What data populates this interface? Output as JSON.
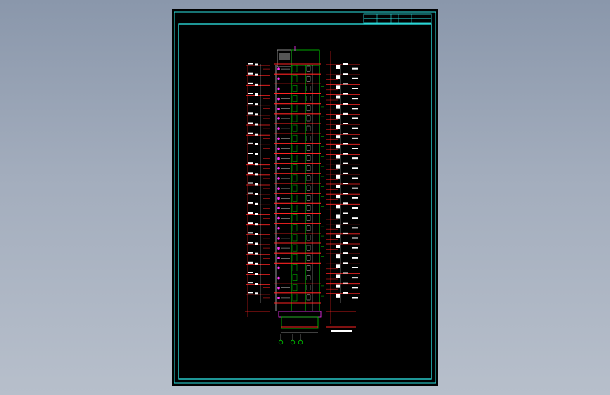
{
  "viewport": {
    "background_top": "#8a97ab",
    "background_bottom": "#b7bfcb"
  },
  "drawing": {
    "sheet_background": "#000000",
    "border_color": "#2ee6e6",
    "title_block": {
      "cells": [
        "",
        "",
        "",
        "",
        ""
      ]
    },
    "building": {
      "floors": 24,
      "wall_color": "#00d000",
      "slab_color": "#ff2222",
      "grid_color": "#ffffff",
      "accent_color": "#ff33ff",
      "roof_color": "#b0b0b0"
    },
    "caption": "",
    "axis_markers": 3
  }
}
